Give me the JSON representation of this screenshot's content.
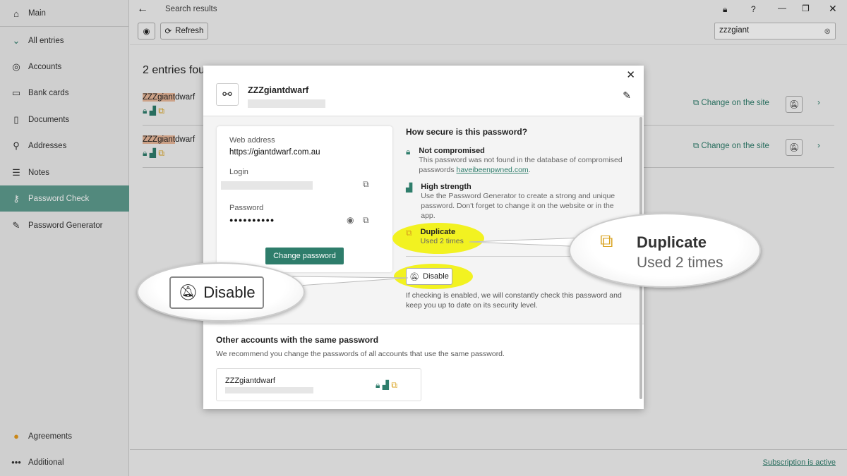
{
  "sidebar": {
    "main": "Main",
    "all_entries": "All entries",
    "items": [
      "Accounts",
      "Bank cards",
      "Documents",
      "Addresses",
      "Notes",
      "Password Check",
      "Password Generator"
    ],
    "agreements": "Agreements",
    "additional": "Additional"
  },
  "topbar": {
    "title": "Search results",
    "refresh": "Refresh",
    "search_value": "zzzgiant"
  },
  "results": {
    "heading": "2 entries fou",
    "rows": [
      {
        "hl": "ZZZgiant",
        "rest": "dwarf",
        "action": "Change on the site"
      },
      {
        "hl": "ZZZgiant",
        "rest": "dwarf",
        "action": "Change on the site"
      }
    ]
  },
  "status": {
    "subscription": "Subscription is active"
  },
  "modal": {
    "title": "ZZZgiantdwarf",
    "web_label": "Web address",
    "web_value": "https://giantdwarf.com.au",
    "login_label": "Login",
    "password_label": "Password",
    "password_value": "●●●●●●●●●●",
    "change_password": "Change password",
    "security_heading": "How secure is this password?",
    "checks": [
      {
        "title": "Not compromised",
        "desc": "This password was not found in the database of compromised passwords ",
        "link": "haveibeenpwned.com"
      },
      {
        "title": "High strength",
        "desc": "Use the Password Generator to create a strong and unique password. Don't forget to change it on the website or in the app."
      },
      {
        "title": "Duplicate",
        "desc": "Used 2 times"
      }
    ],
    "disable": "Disable",
    "disable_desc": "If checking is enabled, we will constantly check this password and keep you up to date on its security level.",
    "other_heading": "Other accounts with the same password",
    "other_desc": "We recommend you change the passwords of all accounts that use the same password.",
    "other_entry": "ZZZgiantdwarf"
  },
  "callouts": {
    "duplicate_title": "Duplicate",
    "duplicate_desc": "Used 2 times",
    "disable": "Disable"
  }
}
